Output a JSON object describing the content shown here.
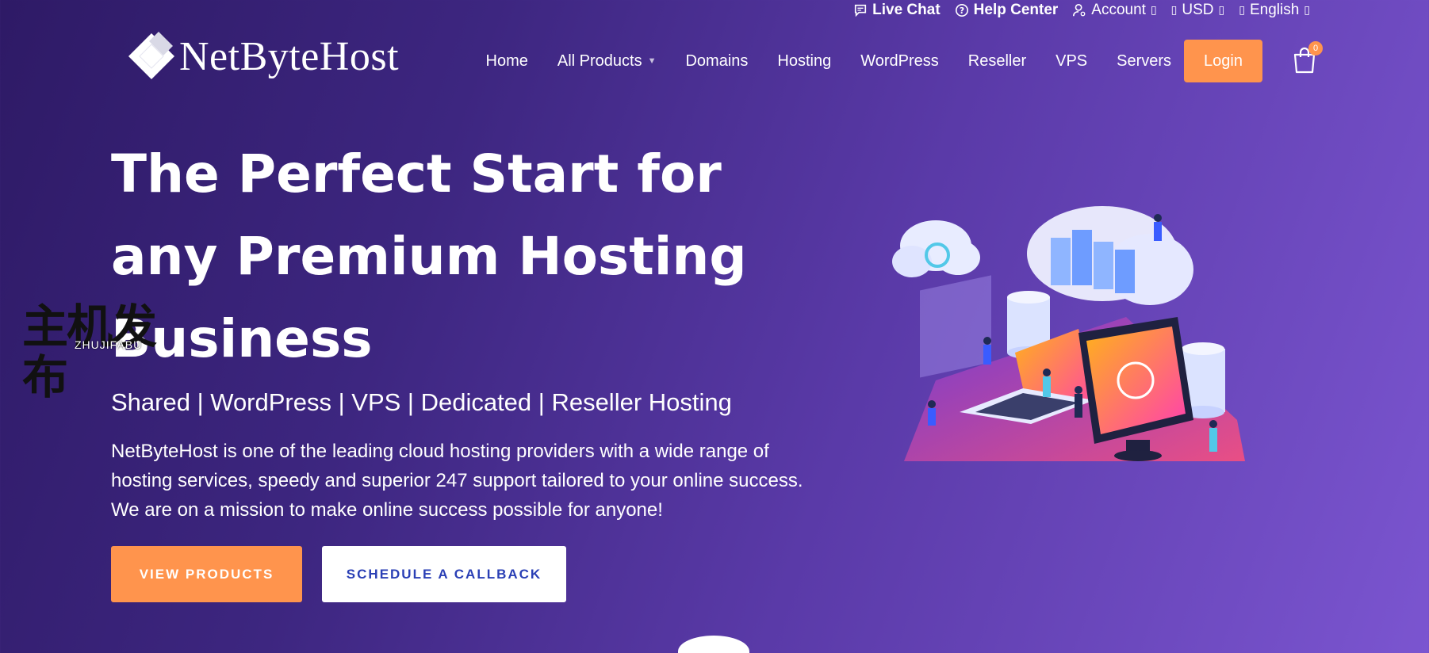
{
  "topbar": {
    "live_chat": "Live Chat",
    "help_center": "Help Center",
    "account": "Account",
    "currency": "USD",
    "language": "English",
    "box_glyph": "▯"
  },
  "brand": {
    "name": "NetByteHost"
  },
  "nav": {
    "items": [
      "Home",
      "All Products",
      "Domains",
      "Hosting",
      "WordPress",
      "Reseller",
      "VPS",
      "Servers"
    ],
    "login": "Login",
    "cart_count": "0"
  },
  "hero": {
    "title": "The Perfect Start for any Premium Hosting Business",
    "subtitle": "Shared | WordPress | VPS | Dedicated | Reseller Hosting",
    "description": "NetByteHost is one of the leading cloud hosting providers with a wide range of hosting services, speedy and superior 247 support tailored to your online success. We are on a mission to make online success possible for anyone!",
    "primary_button": "VIEW PRODUCTS",
    "secondary_button": "SCHEDULE A CALLBACK"
  },
  "watermark": {
    "cn": "主机发布",
    "en": "ZHUJIFABU"
  },
  "colors": {
    "accent": "#ff944d",
    "secondary_text": "#2a3fb5",
    "bg_start": "#2e1a66",
    "bg_end": "#7b55d0"
  }
}
